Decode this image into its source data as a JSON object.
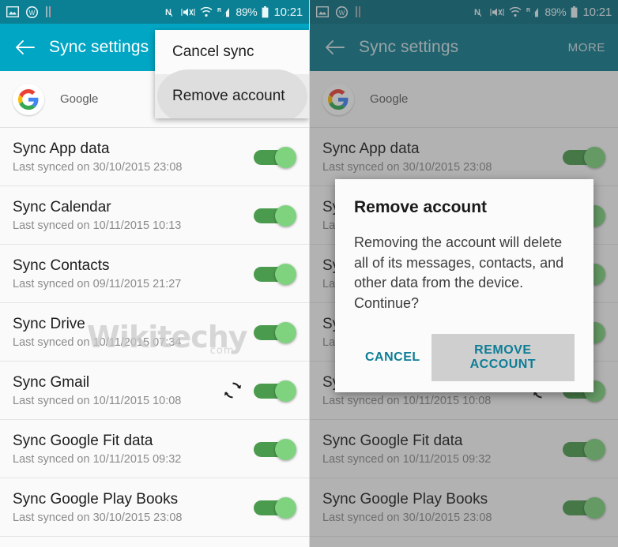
{
  "statusbar": {
    "icons_left": [
      "image-icon",
      "weather-widget-icon",
      "pause-bars-icon"
    ],
    "icons_right": [
      "nfc-icon",
      "vibrate-mute-icon",
      "wifi-icon",
      "signal-roaming-icon"
    ],
    "battery_percent": "89%",
    "battery_icon": "battery-icon",
    "time": "10:21"
  },
  "toolbar": {
    "back_icon": "back-arrow-icon",
    "title": "Sync settings",
    "more_label": "MORE"
  },
  "account": {
    "logo_icon": "google-logo-icon",
    "email_masked": "",
    "type": "Google"
  },
  "menu": {
    "items": [
      {
        "label": "Cancel sync",
        "pressed": false
      },
      {
        "label": "Remove account",
        "pressed": true
      }
    ]
  },
  "dialog": {
    "title": "Remove account",
    "body": "Removing the account will delete all of its messages, contacts, and other data from the device. Continue?",
    "cancel_label": "CANCEL",
    "confirm_label": "REMOVE ACCOUNT"
  },
  "sync_items": [
    {
      "title": "Sync App data",
      "subtitle": "Last synced on 30/10/2015 23:08",
      "toggle_on": true,
      "syncing": false
    },
    {
      "title": "Sync Calendar",
      "subtitle": "Last synced on 10/11/2015 10:13",
      "toggle_on": true,
      "syncing": false
    },
    {
      "title": "Sync Contacts",
      "subtitle": "Last synced on 09/11/2015 21:27",
      "toggle_on": true,
      "syncing": false
    },
    {
      "title": "Sync Drive",
      "subtitle": "Last synced on 10/11/2015 07:34",
      "toggle_on": true,
      "syncing": false
    },
    {
      "title": "Sync Gmail",
      "subtitle": "Last synced on 10/11/2015 10:08",
      "toggle_on": true,
      "syncing": true
    },
    {
      "title": "Sync Google Fit data",
      "subtitle": "Last synced on 10/11/2015 09:32",
      "toggle_on": true,
      "syncing": false
    },
    {
      "title": "Sync Google Play Books",
      "subtitle": "Last synced on 30/10/2015 23:08",
      "toggle_on": true,
      "syncing": false
    }
  ],
  "watermark": {
    "main": "Wikitechy",
    "sub": "com"
  },
  "colors": {
    "status_bar": "#0b7f93",
    "toolbar": "#00a6c4",
    "toggle_track": "#4b9b4e",
    "toggle_thumb": "#7fd37f",
    "dialog_action": "#0d7d96",
    "scrim": "rgba(60,60,60,.38)"
  }
}
